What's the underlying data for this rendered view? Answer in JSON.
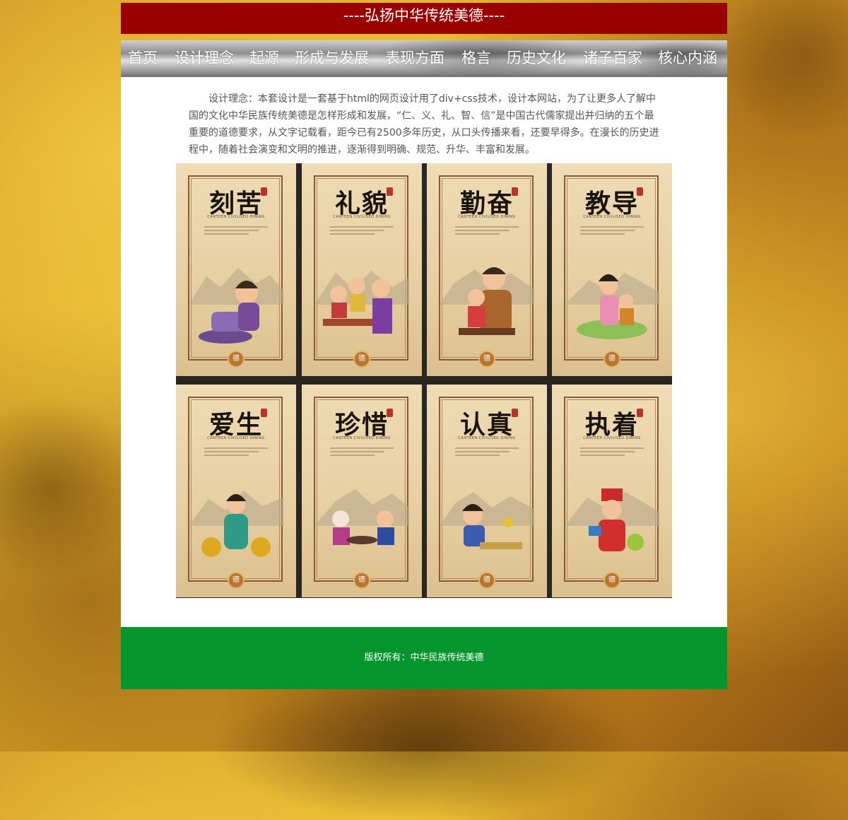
{
  "banner": {
    "title": "----弘扬中华传统美德----"
  },
  "nav": {
    "items": [
      {
        "label": "首页"
      },
      {
        "label": "设计理念"
      },
      {
        "label": "起源"
      },
      {
        "label": "形成与发展"
      },
      {
        "label": "表现方面"
      },
      {
        "label": "格言"
      },
      {
        "label": "历史文化"
      },
      {
        "label": "诸子百家"
      },
      {
        "label": "核心内涵"
      }
    ]
  },
  "content": {
    "intro": "设计理念：本套设计是一套基于html的网页设计用了div+css技术，设计本网站，为了让更多人了解中国的文化中华民族传统美德是怎样形成和发展，“仁、义、礼、智、信”是中国古代儒家提出并归纳的五个最重要的道德要求，从文字记载看，距今已有2500多年历史，从口头传播来看，还要早得多。在漫长的历史进程中，随着社会演变和文明的推进，逐渐得到明确、规范、升华、丰富和发展。",
    "posters": [
      {
        "title": "刻苦",
        "subtitle": "CANTEEN CIVILISED DINING",
        "badge": "德"
      },
      {
        "title": "礼貌",
        "subtitle": "CANTEEN CIVILISED DINING",
        "badge": "德"
      },
      {
        "title": "勤奋",
        "subtitle": "CANTEEN CIVILISED DINING",
        "badge": "德"
      },
      {
        "title": "教导",
        "subtitle": "CANTEEN CIVILISED DINING",
        "badge": "德"
      },
      {
        "title": "爱生",
        "subtitle": "CANTEEN CIVILISED DINING",
        "badge": "德"
      },
      {
        "title": "珍惜",
        "subtitle": "CANTEEN CIVILISED DINING",
        "badge": "德"
      },
      {
        "title": "认真",
        "subtitle": "CANTEEN CIVILISED DINING",
        "badge": "德"
      },
      {
        "title": "执着",
        "subtitle": "CANTEEN CIVILISED DINING",
        "badge": "德"
      }
    ]
  },
  "footer": {
    "copyright": "版权所有：中华民族传统美德"
  },
  "colors": {
    "banner": "#990000",
    "footer": "#04952c",
    "content_bg": "#ffffff",
    "text": "#555555"
  }
}
